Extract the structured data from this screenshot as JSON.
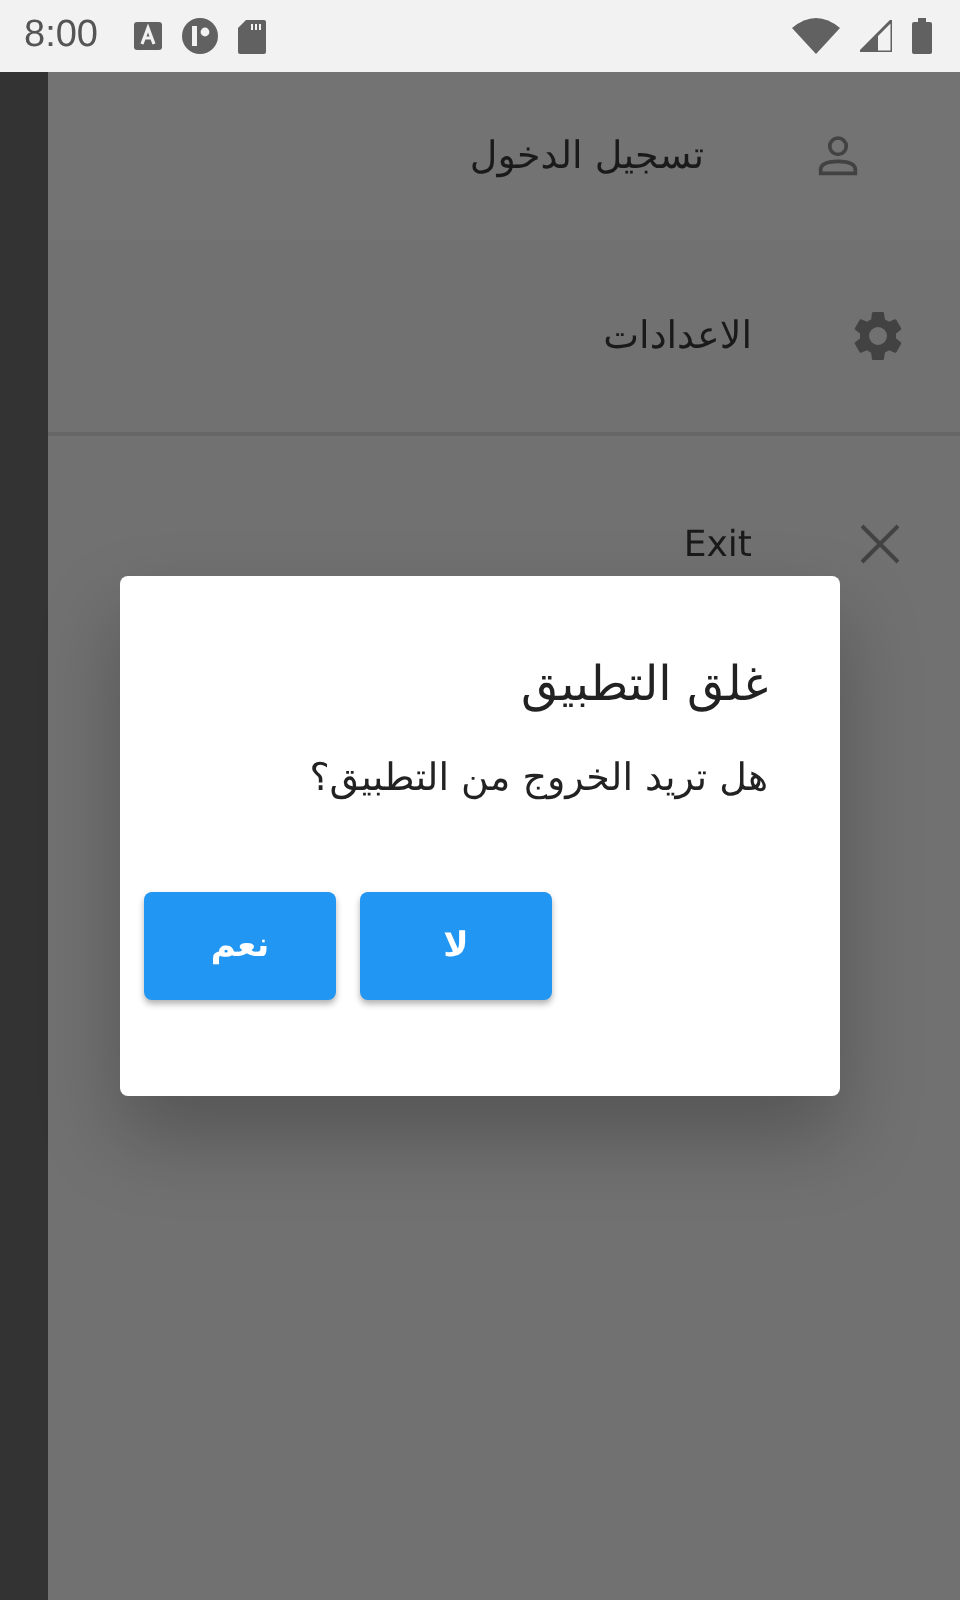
{
  "status_bar": {
    "time": "8:00"
  },
  "drawer": {
    "items": [
      {
        "kind": "user",
        "label": "تسجيل الدخول"
      },
      {
        "kind": "gear",
        "label": "الاعدادات"
      },
      {
        "kind": "close",
        "label": "Exit"
      }
    ]
  },
  "dialog": {
    "title": "غلق التطبيق",
    "message": "هل تريد الخروج من التطبيق؟",
    "buttons": [
      "لا",
      "نعم"
    ]
  }
}
